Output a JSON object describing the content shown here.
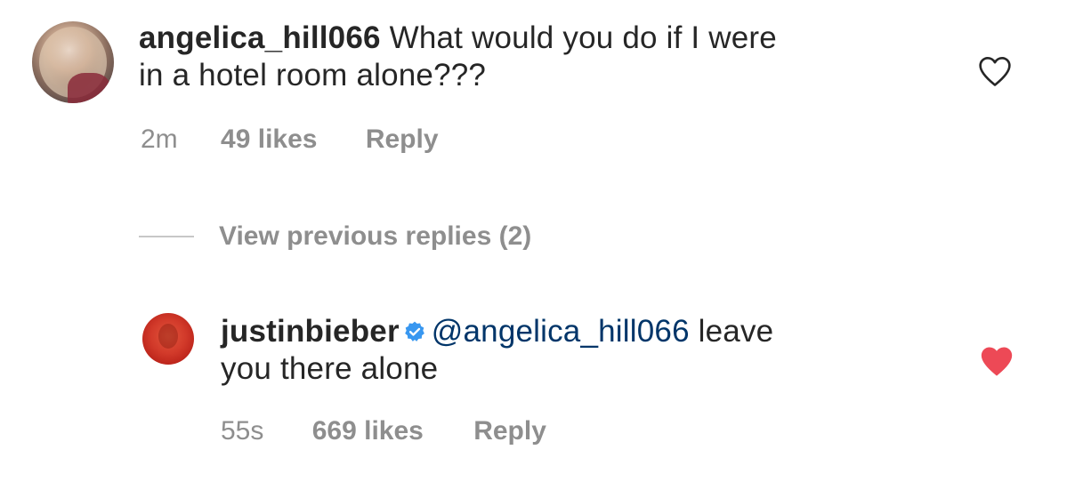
{
  "comments": [
    {
      "username": "angelica_hill066",
      "text_line1": " What would you do if I were",
      "text_line2": "in a hotel room alone???",
      "time": "2m",
      "likes": "49 likes",
      "reply": "Reply",
      "liked": false,
      "icon": "heart-outline-icon"
    },
    {
      "username": "justinbieber",
      "verified_icon": "verified-badge-icon",
      "mention": "@angelica_hill066",
      "text_line1": " leave",
      "text_line2": "you there alone",
      "time": "55s",
      "likes": "669 likes",
      "reply": "Reply",
      "liked": true,
      "icon": "heart-filled-icon"
    }
  ],
  "view_previous_replies": "View previous replies (2)",
  "colors": {
    "text": "#262626",
    "muted": "#8e8e8e",
    "mention": "#003569",
    "liked_heart": "#ed4956",
    "verified": "#3897f0"
  }
}
